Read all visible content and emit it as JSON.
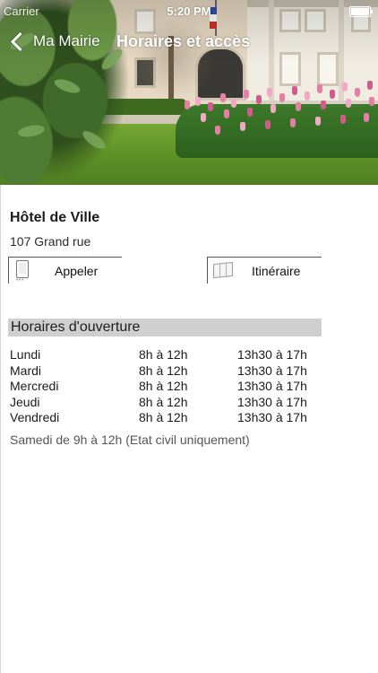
{
  "status_bar": {
    "carrier": "Carrier",
    "time": "5:20 PM",
    "battery_level": 1.0
  },
  "nav": {
    "back_label": "Ma Mairie",
    "title": "Horaires et accès",
    "back_icon": "chevron-left-icon"
  },
  "place": {
    "name": "Hôtel de Ville",
    "address": "107 Grand rue"
  },
  "actions": {
    "call_label": "Appeler",
    "call_icon": "phone-icon",
    "route_label": "Itinéraire",
    "route_icon": "map-icon"
  },
  "hours": {
    "section_title": "Horaires d'ouverture",
    "rows": [
      {
        "day": "Lundi",
        "morning": "8h à 12h",
        "afternoon": "13h30 à 17h"
      },
      {
        "day": "Mardi",
        "morning": "8h à 12h",
        "afternoon": "13h30 à 17h"
      },
      {
        "day": "Mercredi",
        "morning": "8h à 12h",
        "afternoon": "13h30 à 17h"
      },
      {
        "day": "Jeudi",
        "morning": "8h à 12h",
        "afternoon": "13h30 à 17h"
      },
      {
        "day": "Vendredi",
        "morning": "8h à 12h",
        "afternoon": "13h30 à 17h"
      }
    ],
    "note": "Samedi de 9h à 12h (Etat civil uniquement)"
  },
  "colors": {
    "section_header_bg": "#cfcfcf",
    "text": "#1b1b1b",
    "note_text": "#555555"
  }
}
